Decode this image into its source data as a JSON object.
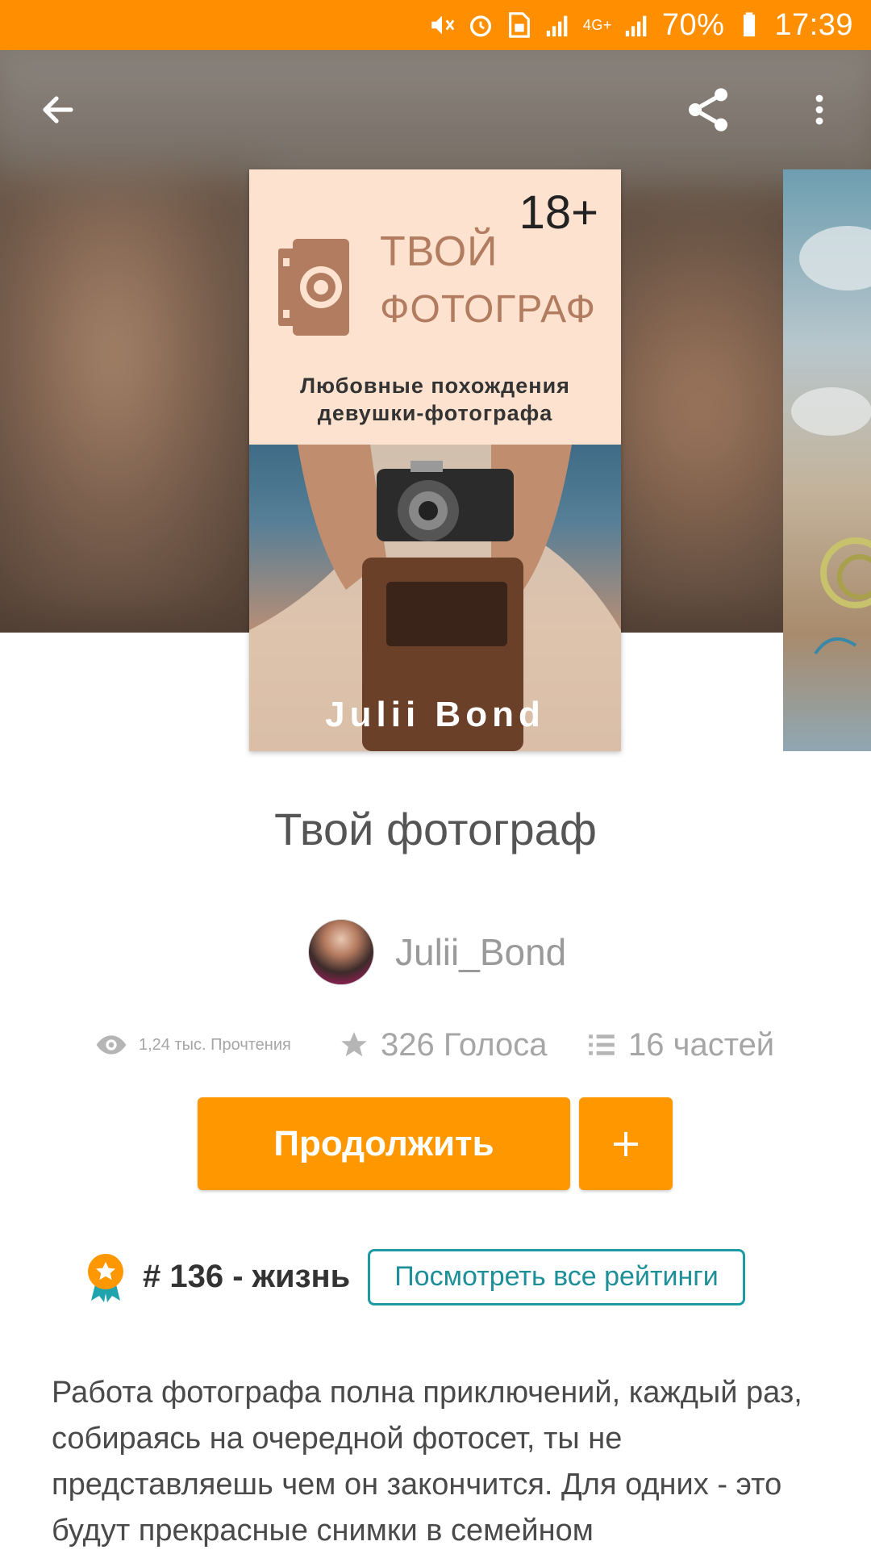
{
  "status_bar": {
    "battery": "70%",
    "time": "17:39",
    "network": "4G+"
  },
  "header": {
    "back_icon": "arrow-left-icon",
    "share_icon": "share-icon",
    "more_icon": "more-vertical-icon"
  },
  "cover": {
    "age_rating": "18+",
    "title_line1": "ТВОЙ",
    "title_line2": "ФОТОГРАФ",
    "subtitle_line1": "Любовные похождения",
    "subtitle_line2": "девушки-фотографа",
    "author": "Julii Bond"
  },
  "story": {
    "title": "Твой фотограф",
    "author_name": "Julii_Bond",
    "reads": "1,24 тыс. Прочтения",
    "votes": "326 Голоса",
    "parts": "16 частей"
  },
  "actions": {
    "continue_label": "Продолжить",
    "add_label": "+"
  },
  "ranking": {
    "text": "# 136 - жизнь",
    "button_label": "Посмотреть все рейтинги"
  },
  "description": "Работа фотографа полна приключений, каждый раз, собираясь на очередной фотосет, ты не представляешь чем он закончится. Для одних - это будут прекрасные снимки в семейном",
  "colors": {
    "accent": "#ff9800",
    "status_bar": "#ff8f00",
    "link": "#1d9aa3"
  }
}
